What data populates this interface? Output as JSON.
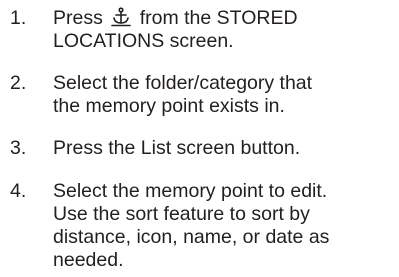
{
  "steps": [
    {
      "number": "1.",
      "lines": [
        "Press",
        "from the STORED",
        "LOCATIONS screen."
      ],
      "icon": "anchor-icon"
    },
    {
      "number": "2.",
      "lines": [
        "Select the folder/category that",
        "the memory point exists in."
      ]
    },
    {
      "number": "3.",
      "lines": [
        "Press the List screen button."
      ]
    },
    {
      "number": "4.",
      "lines": [
        "Select the memory point to edit.",
        "Use the sort feature to sort by",
        "distance, icon, name, or date as",
        "needed."
      ]
    }
  ]
}
